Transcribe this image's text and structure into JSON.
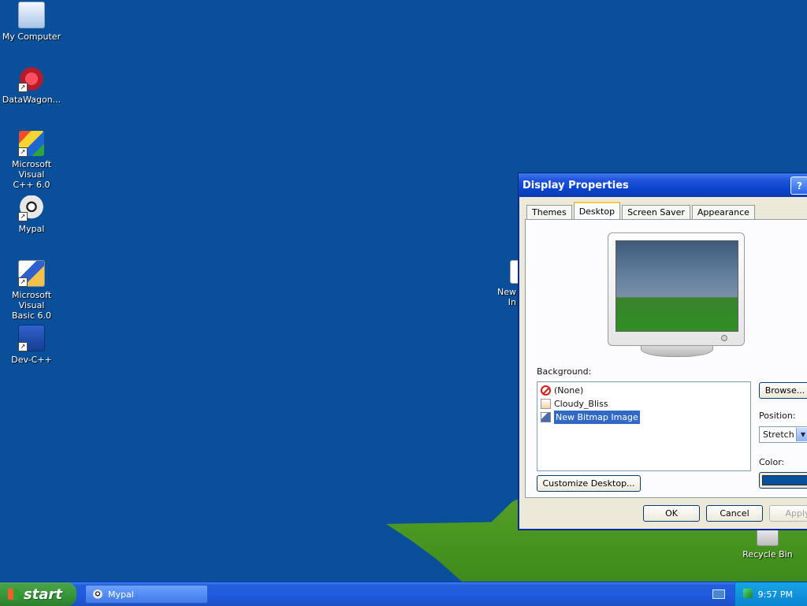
{
  "desktop": {
    "background_color": "#0a4f9a",
    "icons": [
      {
        "label": "My Computer",
        "icon": "my-computer-icon"
      },
      {
        "label": "DataWagon...",
        "icon": "datawagon-icon"
      },
      {
        "label": "Microsoft Visual\nC++ 6.0",
        "icon": "visual-cpp-icon"
      },
      {
        "label": "Mypal",
        "icon": "mypal-icon"
      },
      {
        "label": "Microsoft Visual\nBasic 6.0",
        "icon": "visual-basic-icon"
      },
      {
        "label": "Dev-C++",
        "icon": "devcpp-icon"
      }
    ],
    "partial_icon": {
      "label": "New\nIn",
      "icon": "bitmap-file-icon"
    },
    "recycle_bin": {
      "label": "Recycle Bin",
      "icon": "recycle-bin-icon"
    }
  },
  "dialog": {
    "title": "Display Properties",
    "help_button": "?",
    "tabs": [
      "Themes",
      "Desktop",
      "Screen Saver",
      "Appearance"
    ],
    "active_tab": "Desktop",
    "background_label": "Background:",
    "background_items": [
      {
        "label": "(None)",
        "icon": "none-icon"
      },
      {
        "label": "Cloudy_Bliss",
        "icon": "image-file-icon"
      },
      {
        "label": "New Bitmap Image",
        "icon": "bitmap-file-icon"
      }
    ],
    "selected_background": "New Bitmap Image",
    "browse_button": "Browse...",
    "position_label": "Position:",
    "position_value": "Stretch",
    "color_label": "Color:",
    "color_value": "#0a4f9a",
    "customize_button": "Customize Desktop...",
    "ok_button": "OK",
    "cancel_button": "Cancel",
    "apply_button": "Apply"
  },
  "taskbar": {
    "start_label": "start",
    "task_items": [
      {
        "label": "Mypal",
        "icon": "mypal-icon"
      }
    ],
    "tray_time": "9:57 PM"
  }
}
